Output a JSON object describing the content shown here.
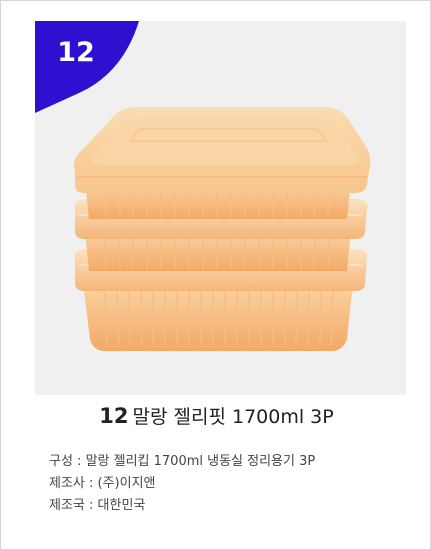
{
  "badge": {
    "number": "12",
    "color": "#2d10d0"
  },
  "product": {
    "image_description_icon": "food-container-stack-icon",
    "number": "12",
    "name": "말랑 젤리핏 1700ml 3P",
    "lid_color": "#f9cd96",
    "body_color": "#f7b87a"
  },
  "info": {
    "composition": "구성 : 말랑 젤리킵 1700ml 냉동실 정리용기 3P",
    "manufacturer": "제조사 :  (주)이지앤",
    "country": "제조국 : 대한민국"
  }
}
